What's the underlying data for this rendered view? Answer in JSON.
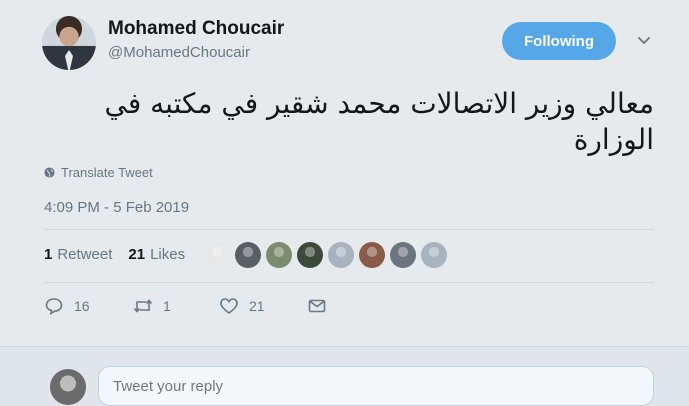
{
  "author": {
    "name": "Mohamed Choucair",
    "handle": "@MohamedChoucair"
  },
  "follow_button": {
    "label": "Following",
    "color": "#56a7e8"
  },
  "tweet": {
    "text": "معالي وزير الاتصالات محمد شقير في مكتبه في الوزارة",
    "translate_label": "Translate Tweet",
    "timestamp": "4:09 PM - 5 Feb 2019"
  },
  "stats": {
    "retweets_count": "1",
    "retweets_label": "Retweet",
    "likes_count": "21",
    "likes_label": "Likes"
  },
  "likers": [
    {
      "color": "#e8e8e8"
    },
    {
      "color": "#5a5f66"
    },
    {
      "color": "#7c8a6e"
    },
    {
      "color": "#3d4a3a"
    },
    {
      "color": "#a7b3bf"
    },
    {
      "color": "#8a5a4a"
    },
    {
      "color": "#6c7480"
    },
    {
      "color": "#a7b3bf"
    }
  ],
  "actions": {
    "replies": "16",
    "retweets": "1",
    "likes": "21"
  },
  "reply": {
    "placeholder": "Tweet your reply"
  }
}
